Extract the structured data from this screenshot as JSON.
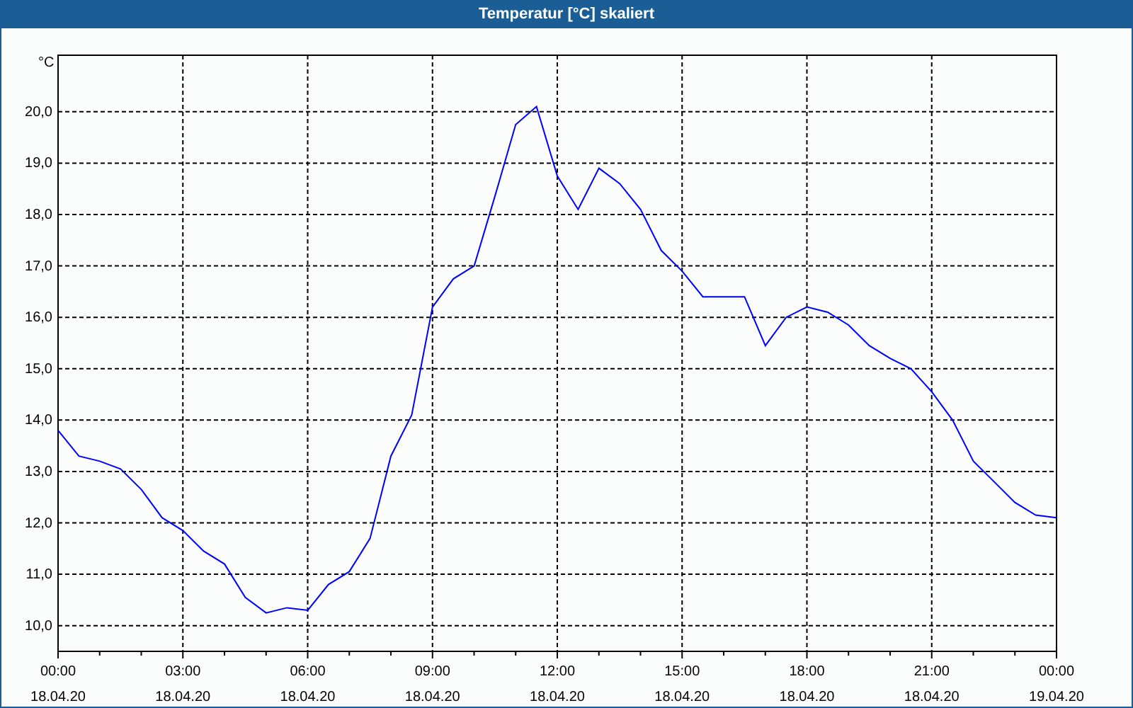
{
  "window": {
    "title": "Temperatur [°C] skaliert"
  },
  "chart": {
    "chart_data": {
      "type": "line",
      "grid": true,
      "ylabel": "°C",
      "ylim": [
        9.5,
        21.1
      ],
      "categories": [
        "00:00\n18.04.20",
        null,
        null,
        null,
        null,
        null,
        "03:00\n18.04.20",
        null,
        null,
        null,
        null,
        null,
        "06:00\n18.04.20",
        null,
        null,
        null,
        null,
        null,
        "09:00\n18.04.20",
        null,
        null,
        null,
        null,
        null,
        "12:00\n18.04.20",
        null,
        null,
        null,
        null,
        null,
        "15:00\n18.04.20",
        null,
        null,
        null,
        null,
        null,
        "18:00\n18.04.20",
        null,
        null,
        null,
        null,
        null,
        "21:00\n18.04.20",
        null,
        null,
        null,
        null,
        null,
        "00:00\n19.04.20"
      ],
      "series": [
        {
          "color": "#0000ff",
          "values": [
            13.8,
            13.3,
            13.2,
            13.05,
            12.65,
            12.1,
            11.85,
            11.45,
            11.2,
            10.55,
            10.25,
            10.35,
            10.3,
            10.8,
            11.05,
            11.7,
            13.3,
            14.1,
            16.2,
            16.75,
            17.0,
            18.35,
            19.75,
            20.1,
            18.75,
            18.1,
            18.9,
            18.6,
            18.1,
            17.3,
            16.9,
            16.4,
            16.4,
            16.4,
            15.45,
            16.0,
            16.2,
            16.1,
            15.85,
            15.45,
            15.2,
            15.0,
            14.55,
            14.0,
            13.2,
            12.8,
            12.4,
            12.15,
            12.1
          ]
        }
      ],
      "yticks": [
        {
          "value": 10,
          "label": "10,0"
        },
        {
          "value": 11,
          "label": "11,0"
        },
        {
          "value": 12,
          "label": "12,0"
        },
        {
          "value": 13,
          "label": "13,0"
        },
        {
          "value": 14,
          "label": "14,0"
        },
        {
          "value": 15,
          "label": "15,0"
        },
        {
          "value": 16,
          "label": "16,0"
        },
        {
          "value": 17,
          "label": "17,0"
        },
        {
          "value": 18,
          "label": "18,0"
        },
        {
          "value": 19,
          "label": "19,0"
        },
        {
          "value": 20,
          "label": "20,0"
        }
      ]
    }
  }
}
